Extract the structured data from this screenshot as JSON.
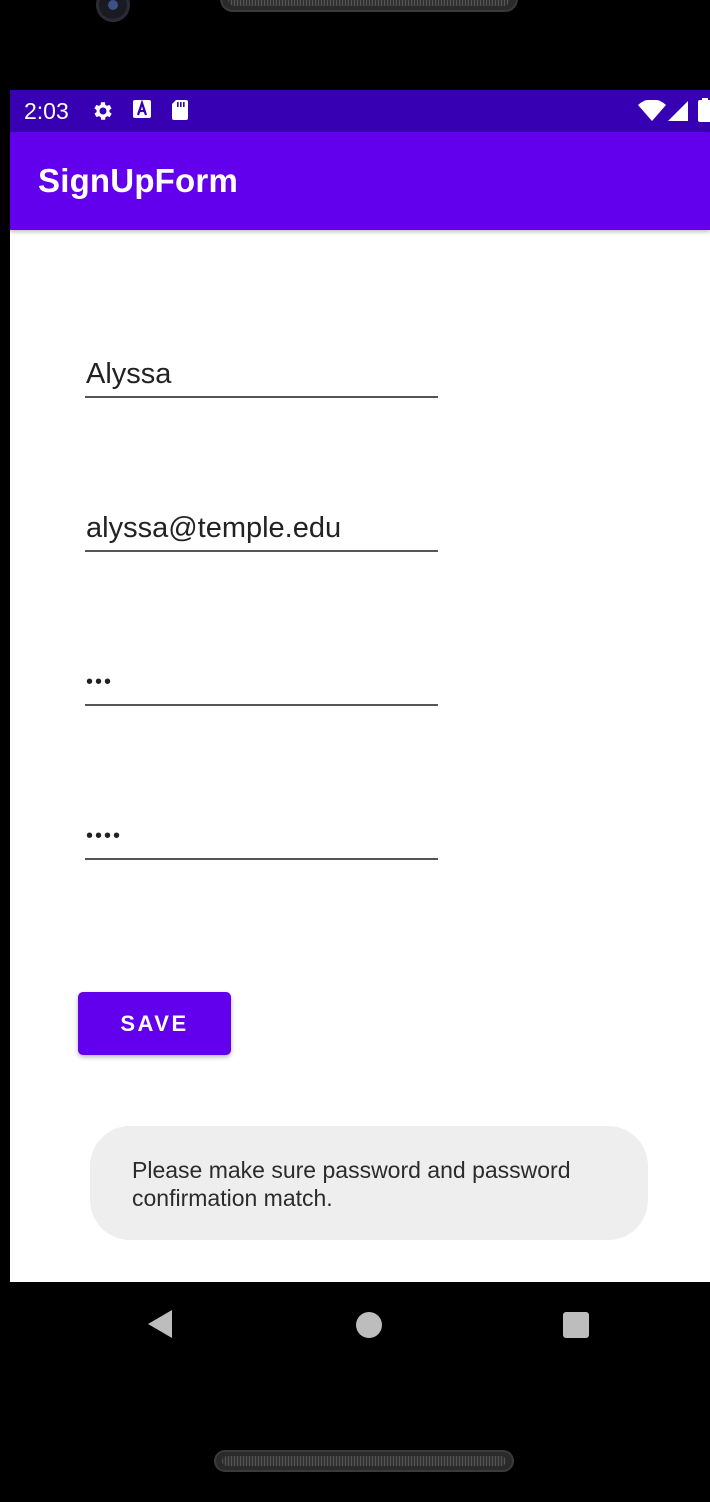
{
  "status_bar": {
    "time": "2:03",
    "left_icons": [
      "gear-icon",
      "keyboard-a-icon",
      "sd-card-icon"
    ],
    "right_icons": [
      "wifi-icon",
      "cell-signal-icon",
      "battery-icon"
    ],
    "color": "#3700b3"
  },
  "app_bar": {
    "title": "SignUpForm",
    "color": "#6200ee"
  },
  "form": {
    "name_value": "Alyssa",
    "email_value": "alyssa@temple.edu",
    "password_value": "•••",
    "confirm_password_value": "••••",
    "save_label": "SAVE"
  },
  "toast": {
    "message": "Please make sure password and password confirmation match."
  },
  "nav_bar": {
    "buttons": [
      "back-icon",
      "home-icon",
      "recents-icon"
    ]
  }
}
